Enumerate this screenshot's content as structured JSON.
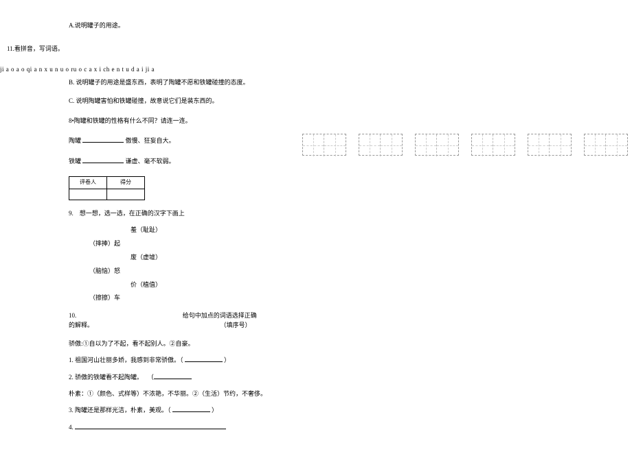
{
  "options": {
    "a": "A.说明罐子的用途。",
    "b": "B. 说明罐子的用途是盛东西，表明了陶罐不愿和铁罐碰撞的态度。",
    "c": "C. 说明陶罐害怕和铁罐碰撞，故意说它们是装东西的。"
  },
  "q11": {
    "title": "11.看拼音，写词语。",
    "pinyin": "ji a o a o qi a n x u n u o ru o c a x i ch e n t u d a i ji a"
  },
  "q8": {
    "text": "8•陶罐和铁罐的性格有什么不同？请连一连。",
    "row1_left": "陶罐",
    "row1_right": "傲慢、狂妄自大。",
    "row2_left": "铁罐",
    "row2_right": "谦虚、毫不软弱。"
  },
  "score_table": {
    "h1": "评卷人",
    "h2": "得分"
  },
  "q9": {
    "title": "9.　想一想，选一选，在正确的汉字下画上",
    "r1a": "（摔捧）起",
    "r1b": "羞（耻趾）",
    "r2a": "（脑恼）怒",
    "r2b": "废（虚墟）",
    "r3a": "（擦擦）车",
    "r3b": "价（植值）"
  },
  "q10": {
    "title_left": "10.",
    "title_right": "给句中加点的词语选择正确",
    "tail": "的解释。",
    "hint": "（填序号）",
    "def1": "骄傲:①自以为了不起，看不起别人。②自豪。",
    "item1": "1. 祖国河山壮丽多娇，我感到非常骄傲。（",
    "item1_end": "）",
    "item2": "2. 骄傲的铁罐看不起陶罐。",
    "def2": "朴素：①（颜色、式样等）不浓艳，不华丽。②（生活）节约，不奢侈。",
    "item3": "3. 陶罐还是那样光洁，朴素，美观。（",
    "item3_end": "）",
    "item4": "4."
  }
}
